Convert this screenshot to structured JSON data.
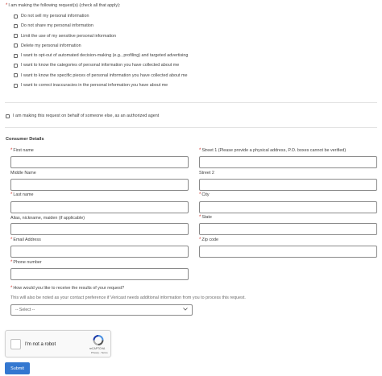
{
  "requests": {
    "label": "I am making the following request(s) (check all that apply):",
    "options": [
      "Do not sell my personal information",
      "Do not share my personal information",
      "Limit the use of my sensitive personal information",
      "Delete my personal information",
      "I want to opt-out of automated decision-making (e.g., profiling) and targeted advertising",
      "I want to know the categories of personal information you have collected about me",
      "I want to know the specific pieces of personal information you have collected about me",
      "I want to correct inaccuracies in the personal information you have about me"
    ]
  },
  "authorized_agent": {
    "label": "I am making this request on behalf of someone else, as an authorized agent"
  },
  "consumer": {
    "title": "Consumer Details",
    "first_name": "First name",
    "middle_name": "Middle Name",
    "last_name": "Last name",
    "alias": "Alias, nickname, maiden (if applicable)",
    "email": "Email Address",
    "phone": "Phone number",
    "street1": "Street 1 (Please provide a physical address, P.O. boxes cannot be verified)",
    "street2": "Street 2",
    "city": "City",
    "state": "State",
    "zip": "Zip code"
  },
  "results": {
    "label": "How would you like to receive the results of your request?",
    "note": "This will also be noted as your contact preference if Vericast needs additional information from you to process this request.",
    "select_value": "-- Select --"
  },
  "recaptcha": {
    "label": "I'm not a robot",
    "brand": "reCAPTCHA",
    "links": "Privacy - Terms"
  },
  "submit": {
    "label": "Submit"
  },
  "colors": {
    "required": "#d0332b",
    "submit_bg": "#3377d0",
    "recaptcha_blue": "#4a90e2"
  }
}
